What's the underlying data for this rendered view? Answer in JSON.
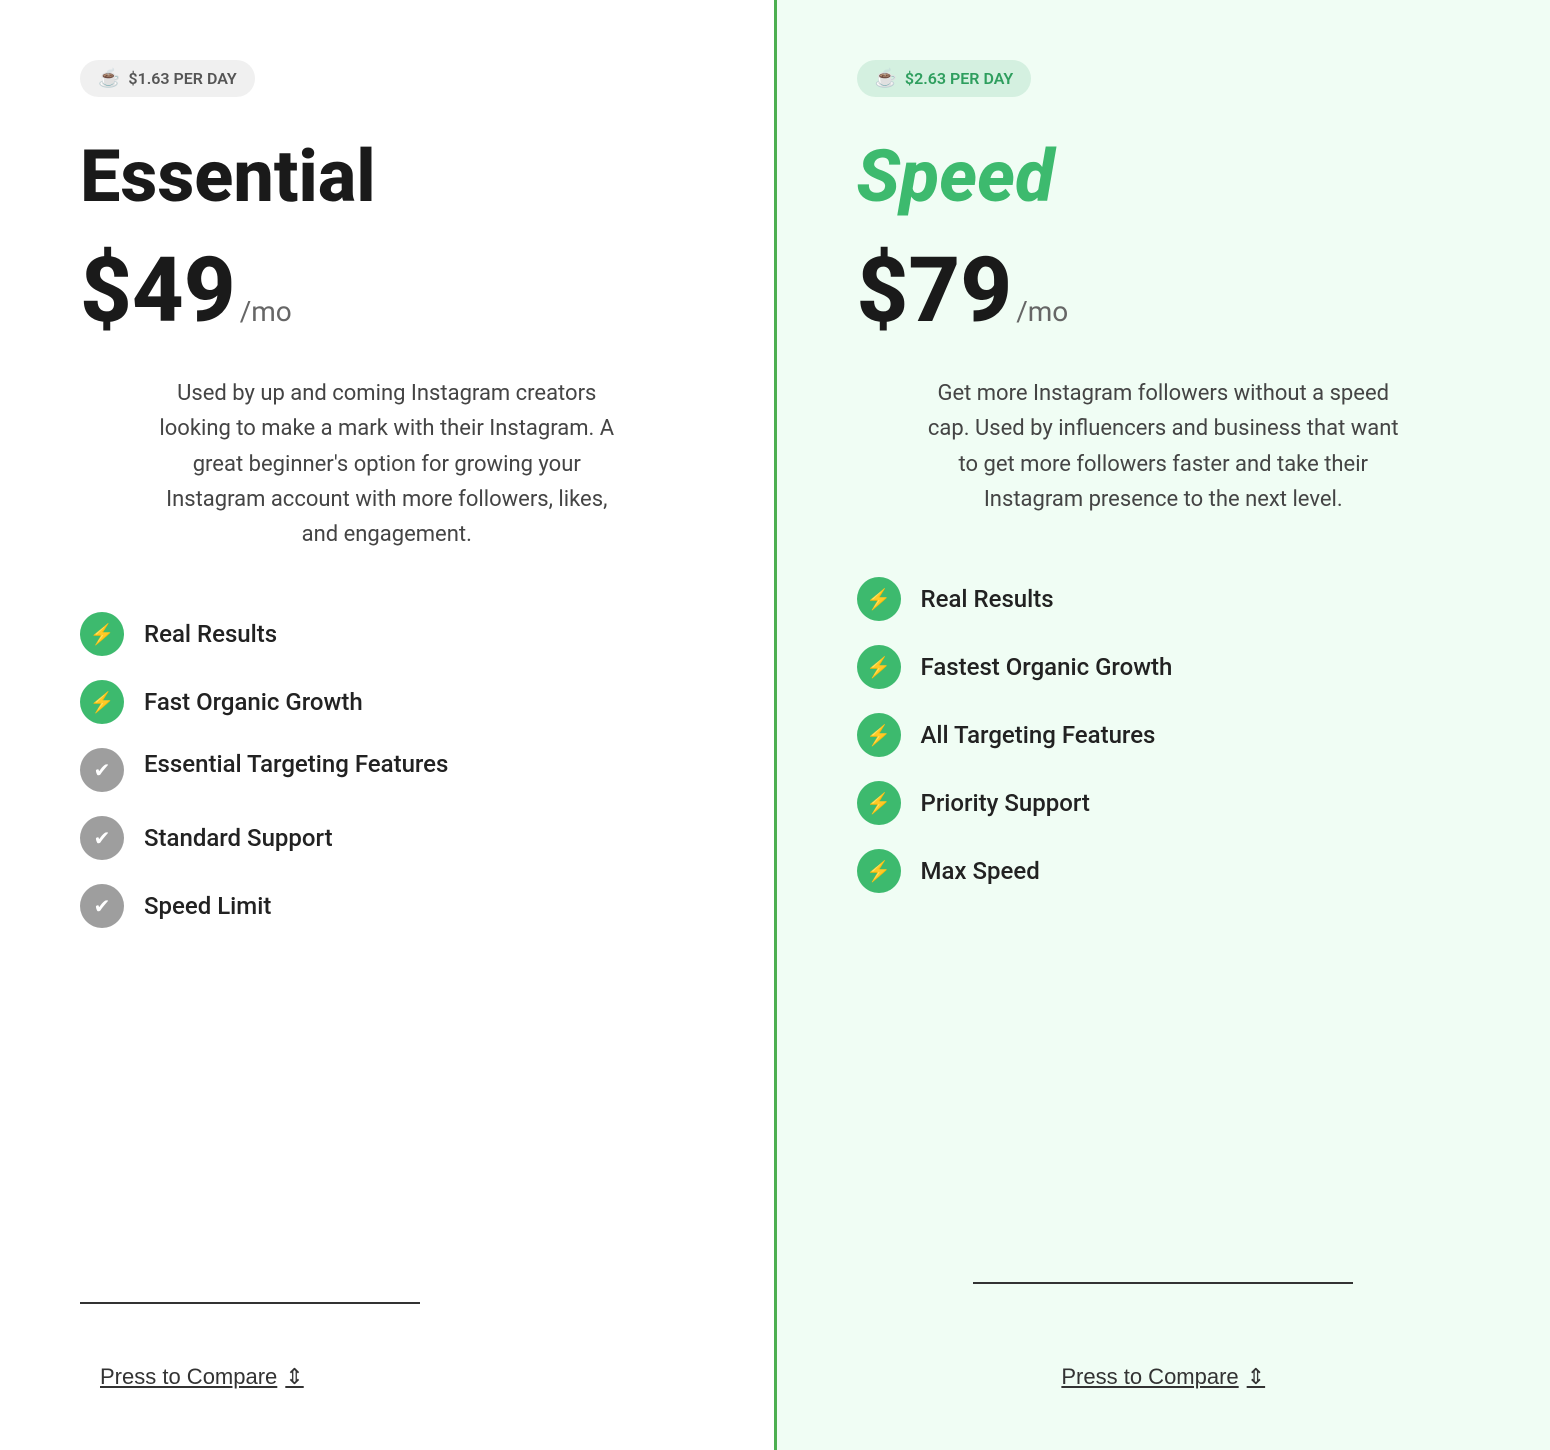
{
  "plans": {
    "essential": {
      "per_day_label": "$1.63 PER DAY",
      "name": "Essential",
      "price": "$49",
      "period": "/mo",
      "description": "Used by up and coming Instagram creators looking to make a mark with their Instagram. A great beginner's option for growing your Instagram account with more followers, likes, and engagement.",
      "features": [
        {
          "label": "Real Results",
          "icon_type": "bolt"
        },
        {
          "label": "Fast Organic Growth",
          "icon_type": "bolt"
        },
        {
          "label": "Essential Targeting Features",
          "icon_type": "check"
        },
        {
          "label": "Standard Support",
          "icon_type": "check"
        },
        {
          "label": "Speed Limit",
          "icon_type": "check"
        }
      ],
      "compare_label": "Press to Compare",
      "compare_symbol": "⇕"
    },
    "speed": {
      "per_day_label": "$2.63 PER DAY",
      "name": "Speed",
      "price": "$79",
      "period": "/mo",
      "description": "Get more Instagram followers without a speed cap. Used by influencers and business that want to get more followers faster and take their Instagram presence to the next level.",
      "features": [
        {
          "label": "Real Results",
          "icon_type": "bolt"
        },
        {
          "label": "Fastest Organic Growth",
          "icon_type": "bolt"
        },
        {
          "label": "All Targeting Features",
          "icon_type": "bolt"
        },
        {
          "label": "Priority Support",
          "icon_type": "bolt"
        },
        {
          "label": "Max Speed",
          "icon_type": "bolt"
        }
      ],
      "compare_label": "Press to Compare",
      "compare_symbol": "⇕"
    }
  }
}
